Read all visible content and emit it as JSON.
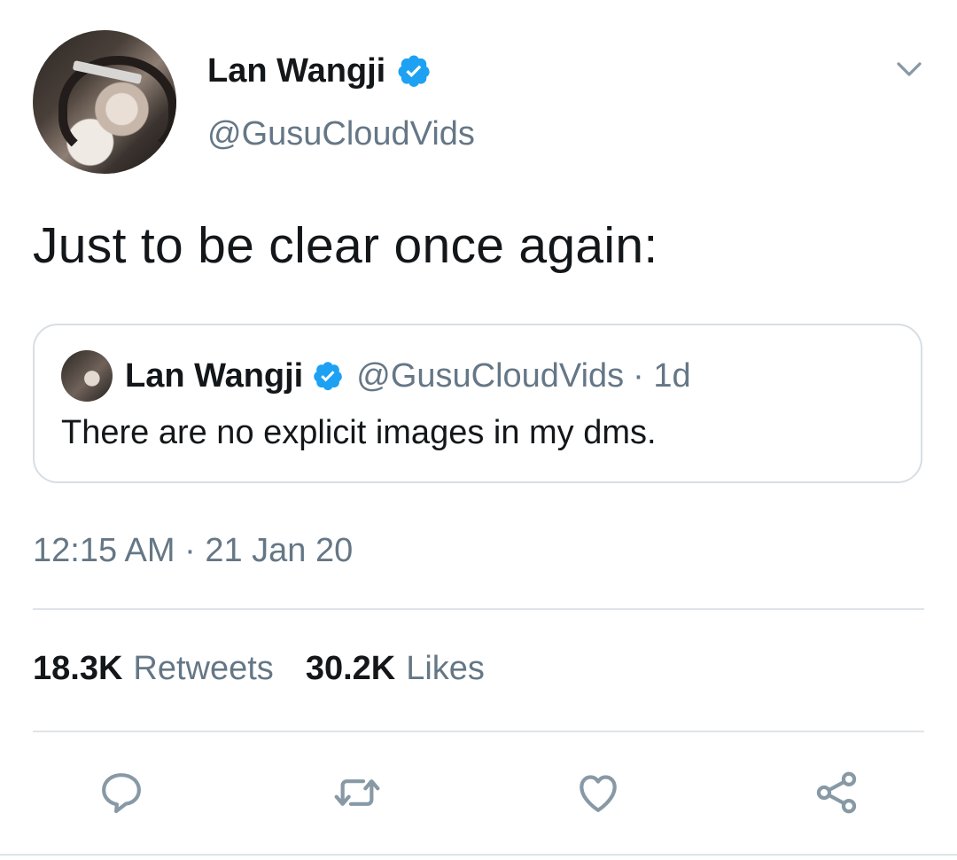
{
  "tweet": {
    "author_name": "Lan Wangji",
    "author_handle": "@GusuCloudVids",
    "text": "Just to be clear once again:",
    "timestamp": "12:15 AM · 21 Jan 20"
  },
  "quoted_tweet": {
    "author_name": "Lan Wangji",
    "author_handle": "@GusuCloudVids",
    "age": "· 1d",
    "text": "There are no explicit images in my dms."
  },
  "stats": {
    "retweets_count": "18.3K",
    "retweets_label": "Retweets",
    "likes_count": "30.2K",
    "likes_label": "Likes"
  },
  "actions": [
    "reply-icon",
    "retweet-icon",
    "like-icon",
    "share-icon"
  ],
  "colors": {
    "verified_blue": "#1da1f2",
    "secondary_text": "#657786",
    "primary_text": "#14171a",
    "divider": "#dfe4e8"
  }
}
